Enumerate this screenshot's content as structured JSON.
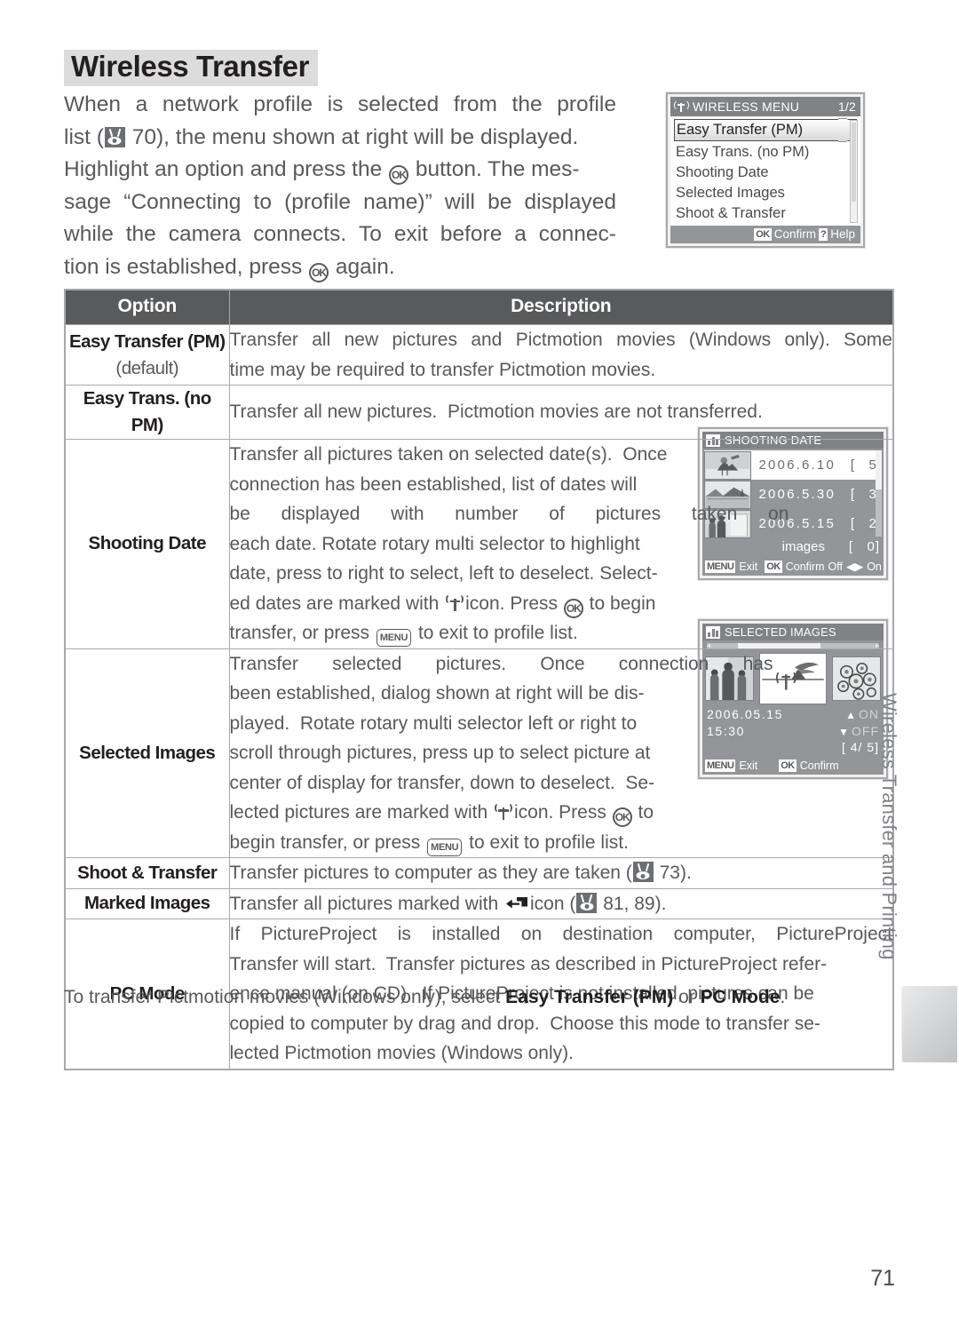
{
  "page": {
    "title": "Wireless Transfer",
    "number": "71",
    "chapter_tab": "Wireless Transfer and Printing"
  },
  "intro": {
    "lines": [
      [
        "When",
        "a",
        "network",
        "profile",
        "is",
        "selected",
        "from",
        "the",
        "profile"
      ],
      [
        "list (",
        "■",
        " 70), the menu shown at right will be displayed."
      ],
      [
        "Highlight an option and press the ",
        "◎",
        " button. The mes-"
      ],
      [
        "sage",
        "“Connecting",
        "to",
        "(profile",
        "name)”",
        "will",
        "be",
        "displayed"
      ],
      [
        "while",
        "the",
        "camera",
        "connects.",
        "To",
        "exit",
        "before",
        "a",
        "connec-"
      ],
      [
        "tion is established, press ",
        "◎",
        " again."
      ]
    ],
    "ref_page": "70"
  },
  "wireless_menu": {
    "title": "WIRELESS MENU",
    "page_indicator": "1/2",
    "items": [
      "Easy Transfer (PM)",
      "Easy Trans. (no PM)",
      "Shooting Date",
      "Selected Images",
      "Shoot & Transfer"
    ],
    "selected_index": 0,
    "footer": {
      "confirm_key": "OK",
      "confirm_label": "Confirm",
      "help_key": "?",
      "help_label": "Help"
    }
  },
  "shooting_date_lcd": {
    "title": "SHOOTING DATE",
    "rows": [
      {
        "date": "2006.6.10",
        "bracket_open": "[",
        "count": "5]",
        "highlighted": true
      },
      {
        "date": "2006.5.30",
        "bracket_open": "[",
        "count": "3]",
        "highlighted": false
      },
      {
        "date": "2006.5.15",
        "bracket_open": "[",
        "count": "2]",
        "highlighted": false
      }
    ],
    "total_label": "images",
    "total_bracket": "[",
    "total_count": "0]",
    "footer": {
      "exit_key": "MENU",
      "exit_label": "Exit",
      "confirm_key": "OK",
      "confirm_label": "Confirm",
      "off_label": "Off",
      "on_label": "On"
    }
  },
  "selected_images_lcd": {
    "title": "SELECTED IMAGES",
    "date": "2006.05.15",
    "time": "15:30",
    "on_label": "ON",
    "off_label": "OFF",
    "counter": "[     4/     5]",
    "footer": {
      "exit_key": "MENU",
      "exit_label": "Exit",
      "confirm_key": "OK",
      "confirm_label": "Confirm"
    }
  },
  "table": {
    "headers": {
      "option": "Option",
      "description": "Description"
    },
    "rows": [
      {
        "option": "Easy Transfer (PM)",
        "option_sub": "(default)",
        "desc_lines": [
          [
            "Transfer",
            "all",
            "new",
            "pictures",
            "and",
            "Pictmotion",
            "movies",
            "(Windows",
            "only).",
            "Some"
          ],
          [
            "time may be required to transfer Pictmotion movies."
          ]
        ]
      },
      {
        "option": "Easy Trans. (no PM)",
        "option_sub": "",
        "desc_lines": [
          [
            "Transfer all new pictures.  Pictmotion movies are not transferred."
          ]
        ]
      },
      {
        "option": "Shooting Date",
        "option_sub": "",
        "desc_lines": [
          [
            "Transfer all pictures taken on selected date(s).  Once"
          ],
          [
            "connection has been established, list of dates will"
          ],
          [
            "be",
            "displayed",
            "with",
            "number",
            "of",
            "pictures",
            "taken",
            "on"
          ],
          [
            "each date.  Rotate rotary multi selector to highlight"
          ],
          [
            "date, press to right to select, left to deselect.  Select-"
          ],
          [
            "ed dates are marked with ■ icon.  Press ◎ to begin"
          ],
          [
            "transfer, or press MENU to exit to profile list."
          ]
        ]
      },
      {
        "option": "Selected Images",
        "option_sub": "",
        "desc_lines": [
          [
            "Transfer",
            "selected",
            "pictures.",
            "Once",
            "connection",
            "has"
          ],
          [
            "been established, dialog shown at right will be dis-"
          ],
          [
            "played.  Rotate rotary multi selector left or right to"
          ],
          [
            "scroll through pictures, press up to select picture at"
          ],
          [
            "center of display for transfer, down to deselect.  Se-"
          ],
          [
            "lected pictures are marked with ■ icon.  Press ◎ to"
          ],
          [
            "begin transfer, or press MENU to exit to profile list."
          ]
        ]
      },
      {
        "option": "Shoot & Transfer",
        "option_sub": "",
        "desc_lines": [
          [
            "Transfer pictures to computer as they are taken (■ 73)."
          ]
        ],
        "ref_pages": "73"
      },
      {
        "option": "Marked Images",
        "option_sub": "",
        "desc_lines": [
          [
            "Transfer all pictures marked with ■ icon (■ 81, 89)."
          ]
        ],
        "ref_pages": "81, 89"
      },
      {
        "option": "PC Mode",
        "option_sub": "",
        "desc_lines": [
          [
            "If",
            "PictureProject",
            "is",
            "installed",
            "on",
            "destination",
            "computer,",
            "PictureProject"
          ],
          [
            "Transfer will start.  Transfer pictures as described in PictureProject refer-"
          ],
          [
            "ence manual (on CD).  If PictureProject is not installed, pictures can be"
          ],
          [
            "copied to computer by drag and drop.  Choose this mode to transfer se-"
          ],
          [
            "lected Pictmotion movies (Windows only)."
          ]
        ]
      }
    ]
  },
  "footnote": {
    "prefix": "To transfer Pictmotion movies (Windows only), select ",
    "bold1": "Easy Transfer (PM)",
    "middle": " or ",
    "bold2": "PC Mode",
    "suffix": "."
  }
}
